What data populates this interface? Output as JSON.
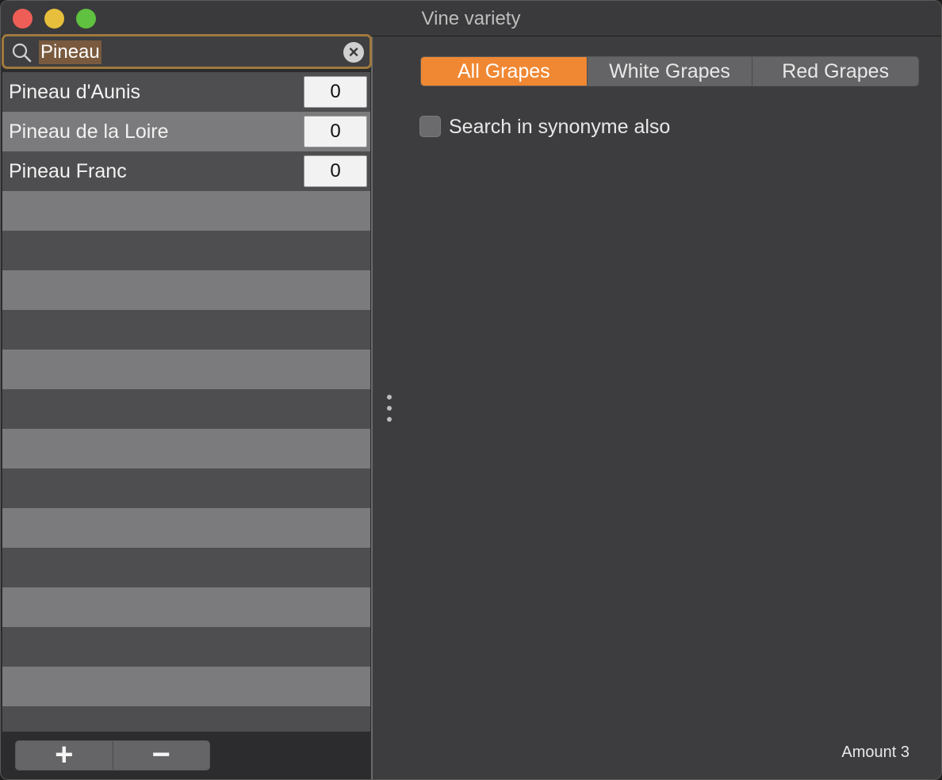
{
  "window": {
    "title": "Vine variety"
  },
  "search": {
    "value": "Pineau"
  },
  "list": {
    "rows": [
      {
        "name": "Pineau d'Aunis",
        "count": "0"
      },
      {
        "name": "Pineau de la Loire",
        "count": "0"
      },
      {
        "name": "Pineau Franc",
        "count": "0"
      }
    ]
  },
  "bottom_bar": {
    "add_label": "+",
    "remove_label": "−"
  },
  "filter": {
    "options": [
      "All Grapes",
      "White Grapes",
      "Red Grapes"
    ],
    "selected": "All Grapes"
  },
  "options": {
    "synonyme_label": "Search in synonyme also",
    "synonyme_checked": false
  },
  "status": {
    "amount": "Amount 3"
  },
  "colors": {
    "accent": "#f08833",
    "focus_ring": "#a0793d",
    "close": "#ee5e57",
    "minimize": "#e7bf3c",
    "maximize": "#5fc13f"
  },
  "icons": {
    "search": "magnifier-icon",
    "clear": "clear-circle-x-icon",
    "split": "vertical-dots-icon"
  }
}
